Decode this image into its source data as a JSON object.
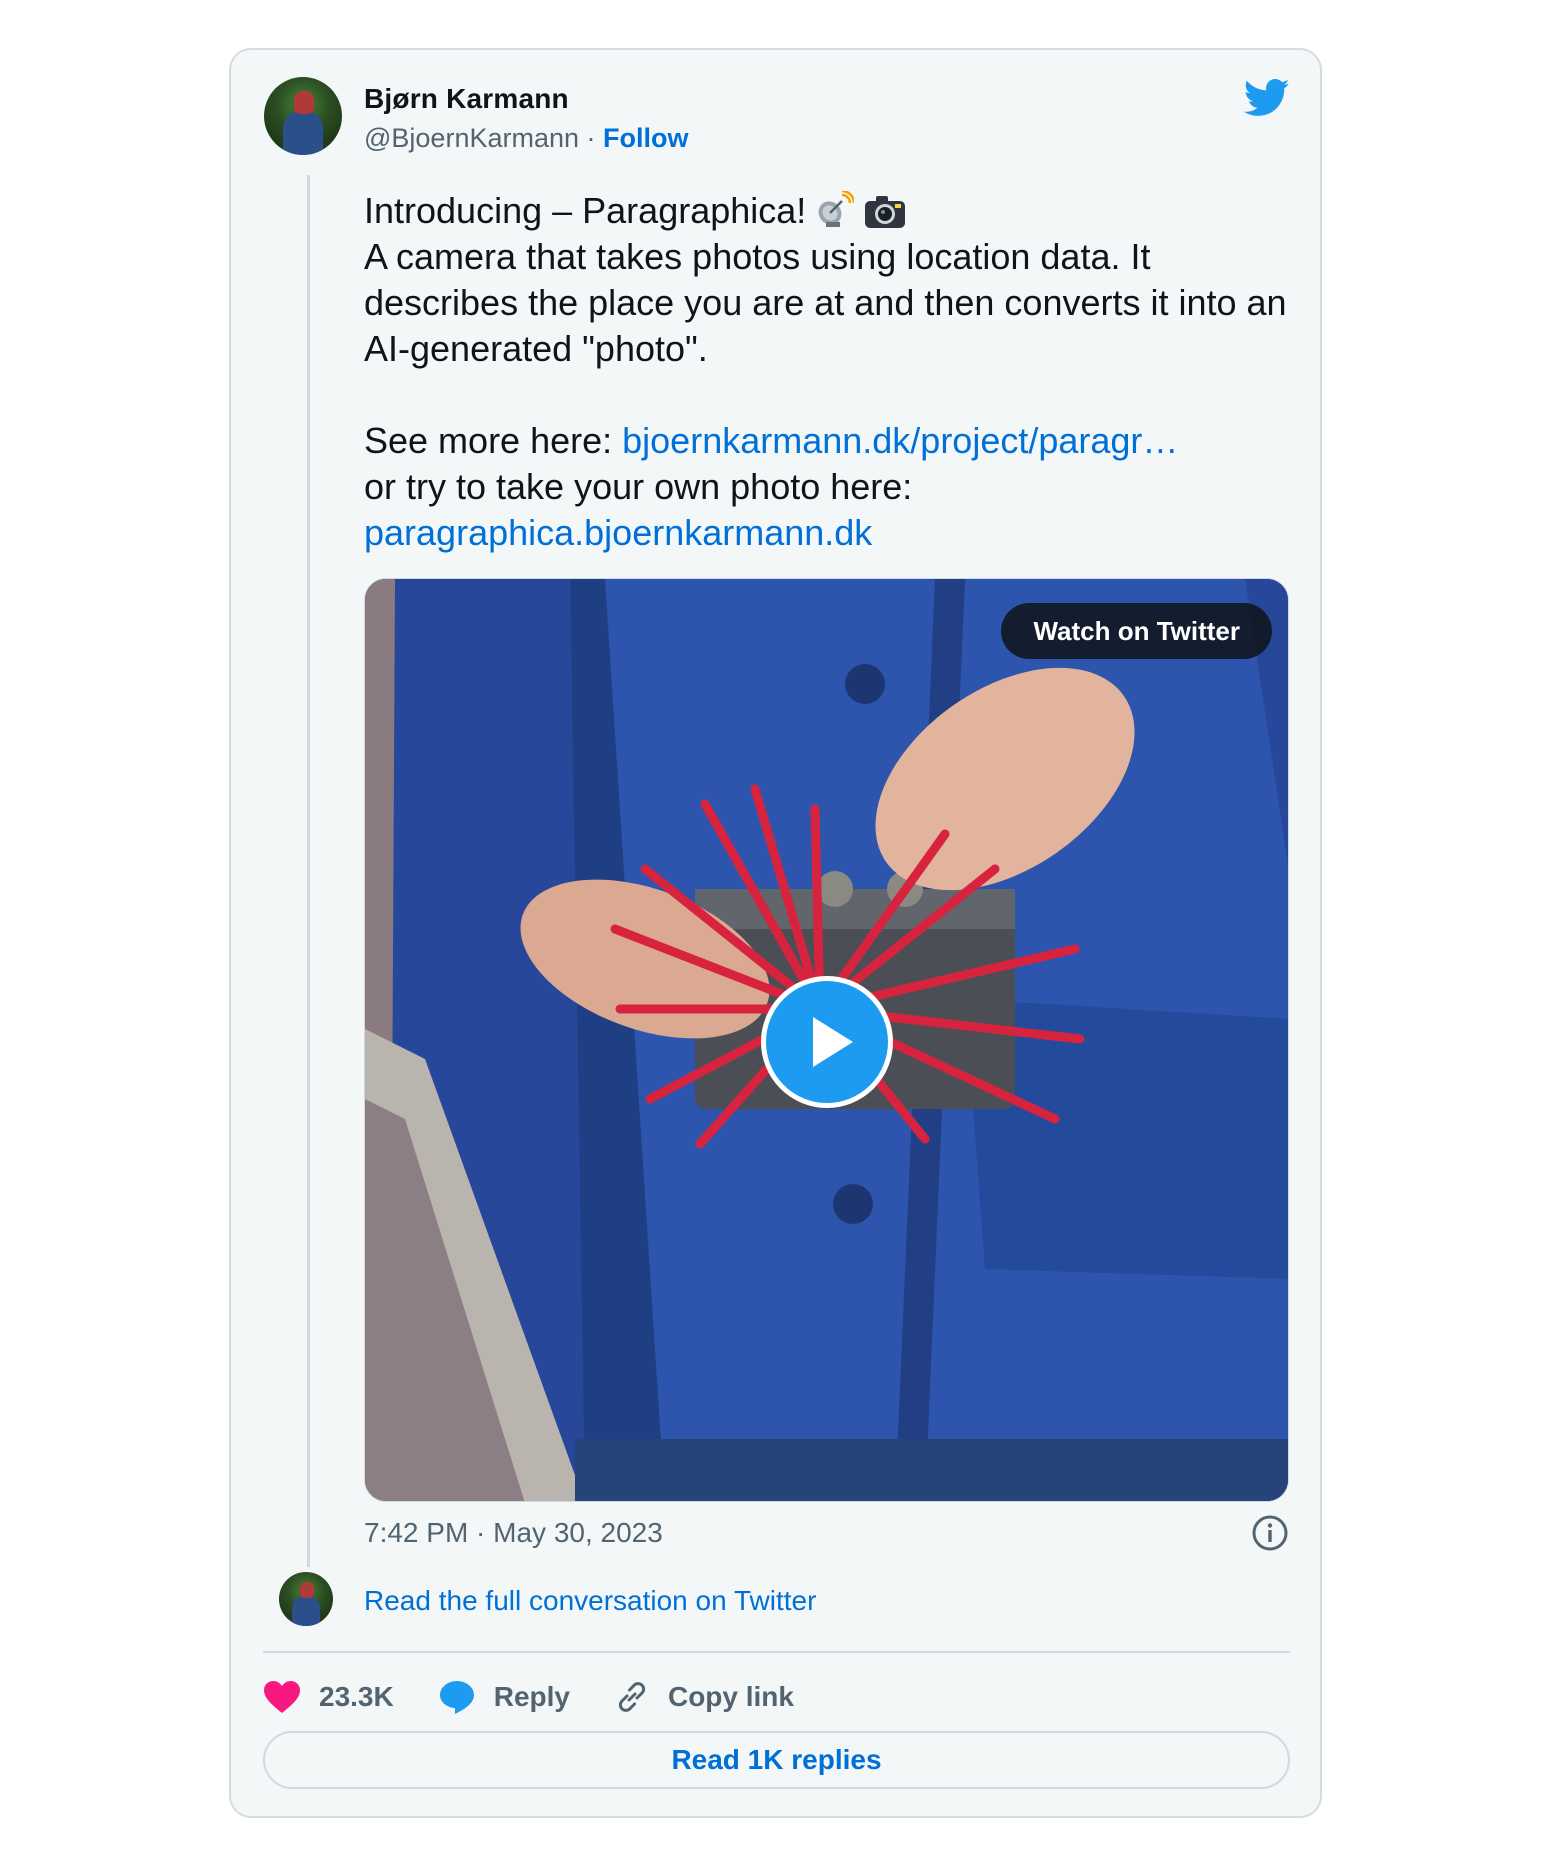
{
  "author": {
    "name": "Bjørn Karmann",
    "handle": "@BjoernKarmann",
    "separator": " · ",
    "follow_label": "Follow"
  },
  "tweet": {
    "line1": "Introducing – Paragraphica! ",
    "line2": "A camera that takes photos using location data. It describes the place you are at and then converts it into an AI-generated \"photo\".",
    "see_more_prefix": "See more here: ",
    "see_more_link": "bjoernkarmann.dk/project/paragr…",
    "try_text": "or try to take your own photo here:",
    "try_link": "paragraphica.bjoernkarmann.dk",
    "emojis": [
      "satellite-antenna",
      "camera-with-flash"
    ]
  },
  "media": {
    "watch_label": "Watch on Twitter"
  },
  "timestamp": "7:42 PM · May 30, 2023",
  "read_conversation": "Read the full conversation on Twitter",
  "actions": {
    "likes": "23.3K",
    "reply_label": "Reply",
    "copy_label": "Copy link"
  },
  "read_replies": "Read 1K replies",
  "colors": {
    "link": "#006fd6",
    "twitter_blue": "#1d9bf0",
    "heart": "#f91880",
    "secondary_text": "#536471"
  }
}
